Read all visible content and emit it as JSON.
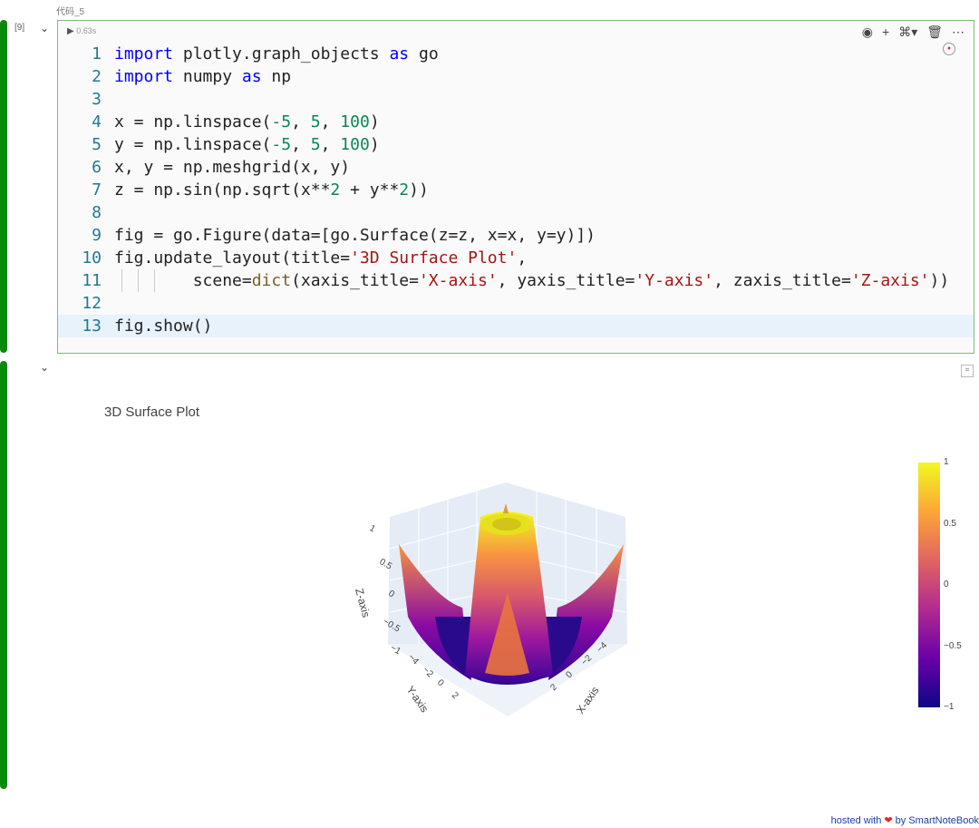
{
  "cell": {
    "name": "代码_5",
    "exec_count": "[9]",
    "run_time": "0.63s"
  },
  "toolbar": {
    "icons": [
      "eye-icon",
      "plus-icon",
      "python-kernel-icon",
      "trash-icon",
      "more-icon"
    ],
    "glyphs": [
      "◉",
      "+",
      "⌘▾",
      "🗑",
      "⋯"
    ]
  },
  "code_lines": [
    [
      [
        "import",
        "kw"
      ],
      [
        " plotly.graph_objects ",
        "id"
      ],
      [
        "as",
        "kw"
      ],
      [
        " go",
        "id"
      ]
    ],
    [
      [
        "import",
        "kw"
      ],
      [
        " numpy ",
        "id"
      ],
      [
        "as",
        "kw"
      ],
      [
        " np",
        "id"
      ]
    ],
    [],
    [
      [
        "x = np.linspace(",
        "id"
      ],
      [
        "-5",
        "num"
      ],
      [
        ", ",
        "id"
      ],
      [
        "5",
        "num"
      ],
      [
        ", ",
        "id"
      ],
      [
        "100",
        "num"
      ],
      [
        ")",
        "id"
      ]
    ],
    [
      [
        "y = np.linspace(",
        "id"
      ],
      [
        "-5",
        "num"
      ],
      [
        ", ",
        "id"
      ],
      [
        "5",
        "num"
      ],
      [
        ", ",
        "id"
      ],
      [
        "100",
        "num"
      ],
      [
        ")",
        "id"
      ]
    ],
    [
      [
        "x, y = np.meshgrid(x, y)",
        "id"
      ]
    ],
    [
      [
        "z = np.sin(np.sqrt(x**",
        "id"
      ],
      [
        "2",
        "num"
      ],
      [
        " + y**",
        "id"
      ],
      [
        "2",
        "num"
      ],
      [
        "))",
        "id"
      ]
    ],
    [],
    [
      [
        "fig = go.Figure(data=[go.Surface(z=z, x=x, y=y)])",
        "id"
      ]
    ],
    [
      [
        "fig.update_layout(title=",
        "id"
      ],
      [
        "'3D Surface Plot'",
        "str"
      ],
      [
        ",",
        "id"
      ]
    ],
    [
      [
        "        scene=",
        "id"
      ],
      [
        "dict",
        "fn"
      ],
      [
        "(xaxis_title=",
        "id"
      ],
      [
        "'X-axis'",
        "str"
      ],
      [
        ", yaxis_title=",
        "id"
      ],
      [
        "'Y-axis'",
        "str"
      ],
      [
        ", zaxis_title=",
        "id"
      ],
      [
        "'Z-axis'",
        "str"
      ],
      [
        "))",
        "id"
      ]
    ],
    [],
    [
      [
        "fig.show()",
        "id"
      ]
    ]
  ],
  "chart_data": {
    "type": "surface",
    "title": "3D Surface Plot",
    "function": "z = sin(sqrt(x^2 + y^2))",
    "x_range": [
      -5,
      5
    ],
    "y_range": [
      -5,
      5
    ],
    "z_range": [
      -1,
      1
    ],
    "xlabel": "X-axis",
    "ylabel": "Y-axis",
    "zlabel": "Z-axis",
    "x_ticks": [
      "−4",
      "−2",
      "0",
      "2"
    ],
    "y_ticks": [
      "−4",
      "−2",
      "0",
      "2"
    ],
    "z_ticks": [
      "−1",
      "−0.5",
      "0",
      "0.5",
      "1"
    ],
    "colorscale": "plasma",
    "colorbar_ticks": [
      "1",
      "0.5",
      "0",
      "−0.5",
      "−1"
    ],
    "colorbar_range": [
      -1,
      1
    ]
  },
  "footer": {
    "text1": "hosted with",
    "text2": "by SmartNoteBook"
  }
}
